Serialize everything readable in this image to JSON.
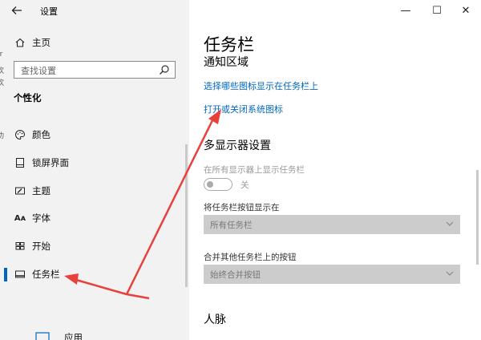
{
  "window": {
    "title": "设置",
    "controls": {
      "minimize": "—",
      "maximize": "☐",
      "close": "✕"
    }
  },
  "sidebar": {
    "home": "主页",
    "search_placeholder": "查找设置",
    "section_title": "个性化",
    "items": [
      {
        "label": "颜色",
        "icon": "palette-icon"
      },
      {
        "label": "锁屏界面",
        "icon": "lock-screen-icon"
      },
      {
        "label": "主题",
        "icon": "theme-icon"
      },
      {
        "label": "字体",
        "icon": "font-icon"
      },
      {
        "label": "开始",
        "icon": "start-icon"
      },
      {
        "label": "任务栏",
        "icon": "taskbar-icon",
        "selected": true
      },
      {
        "label": "应用",
        "icon": "apps-icon"
      }
    ],
    "left_edge_fragments": [
      "Ir",
      "欢",
      "欢",
      "功"
    ]
  },
  "main": {
    "page_title": "任务栏",
    "notification_heading": "通知区域",
    "link_select_icons": "选择哪些图标显示在任务栏上",
    "link_system_icons": "打开或关闭系统图标",
    "multi_display_heading": "多显示器设置",
    "show_on_all_label": "在所有显示器上显示任务栏",
    "toggle_state": "关",
    "buttons_on_label": "将任务栏按钮显示在",
    "buttons_on_value": "所有任务栏",
    "combine_label": "合并其他任务栏上的按钮",
    "combine_value": "始终合并按钮",
    "people_heading": "人脉"
  },
  "colors": {
    "accent": "#0067c0",
    "annotation_arrow": "#e8413c",
    "sidebar_bg": "#f2f2f2",
    "selected_marker": "#0067c0"
  }
}
